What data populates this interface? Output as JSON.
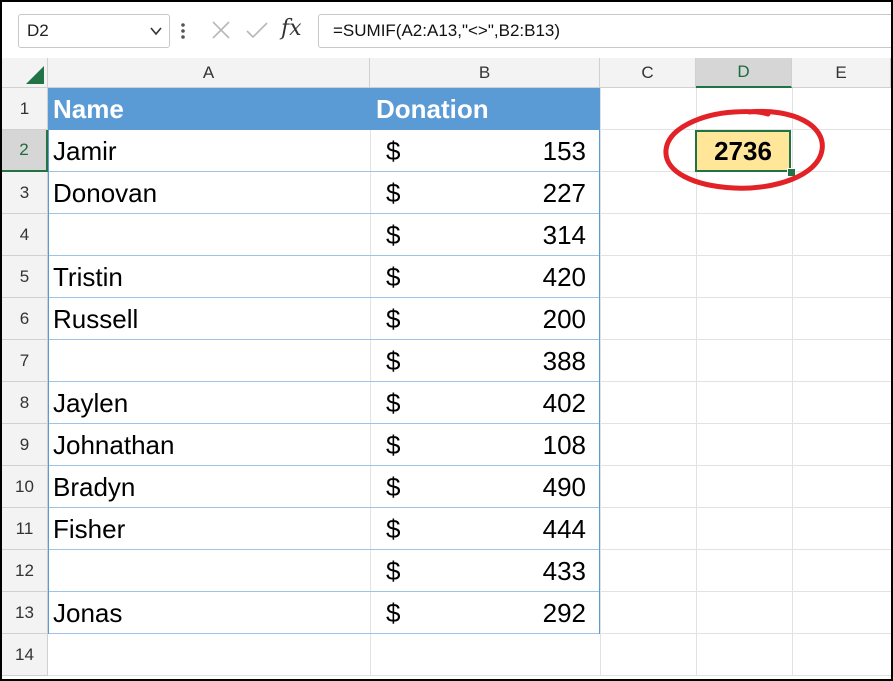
{
  "formula_bar": {
    "name_box": "D2",
    "formula": "=SUMIF(A2:A13,\"<>\",B2:B13)",
    "fx_label": "fx"
  },
  "columns": [
    "A",
    "B",
    "C",
    "D",
    "E"
  ],
  "rows": [
    "1",
    "2",
    "3",
    "4",
    "5",
    "6",
    "7",
    "8",
    "9",
    "10",
    "11",
    "12",
    "13",
    "14"
  ],
  "table": {
    "headers": [
      "Name",
      "Donation"
    ],
    "currency_symbol": "$",
    "names": [
      "Jamir",
      "Donovan",
      "",
      "Tristin",
      "Russell",
      "",
      "Jaylen",
      "Johnathan",
      "Bradyn",
      "Fisher",
      "",
      "Jonas"
    ],
    "amounts": [
      "153",
      "227",
      "314",
      "420",
      "200",
      "388",
      "402",
      "108",
      "490",
      "444",
      "433",
      "292"
    ]
  },
  "result": {
    "cell": "D2",
    "value": "2736"
  },
  "colors": {
    "header_fill": "#5b9bd5",
    "result_fill": "#ffe699",
    "selection": "#217346",
    "circle": "#e32227"
  },
  "icons": [
    "chevron-down-icon",
    "vertical-dots-icon",
    "cancel-x-icon",
    "enter-check-icon",
    "insert-function-icon",
    "select-all-triangle-icon"
  ]
}
